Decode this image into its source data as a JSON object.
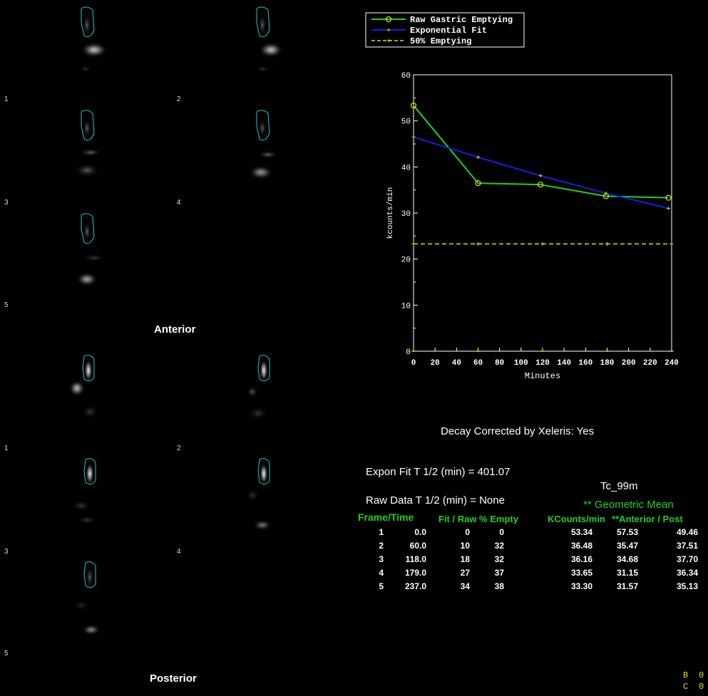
{
  "views": {
    "anterior_label": "Anterior",
    "posterior_label": "Posterior",
    "anterior_frames": [
      "1",
      "2",
      "3",
      "4",
      "5"
    ],
    "posterior_frames": [
      "1",
      "2",
      "3",
      "4",
      "5"
    ]
  },
  "colors": {
    "roi": "#20c8c8",
    "raw": "#20d020",
    "fit": "#1020e0",
    "half": "#e8e000",
    "accent_green": "#20d020"
  },
  "chart_data": {
    "type": "line",
    "xlabel": "Minutes",
    "ylabel": "kcounts/min",
    "xlim": [
      0,
      240
    ],
    "ylim": [
      0,
      60
    ],
    "x_ticks": [
      "0",
      "20",
      "40",
      "60",
      "80",
      "100",
      "120",
      "140",
      "160",
      "180",
      "200",
      "220",
      "240"
    ],
    "y_ticks": [
      "0",
      "10",
      "20",
      "30",
      "40",
      "50",
      "60"
    ],
    "legend_position": "top-left",
    "grid": false,
    "series": [
      {
        "name": "Raw Gastric Emptying",
        "color": "#20d020",
        "marker": "circle",
        "x": [
          0,
          60,
          118,
          179,
          237
        ],
        "y": [
          53.34,
          36.48,
          36.16,
          33.65,
          33.3
        ]
      },
      {
        "name": "Exponential Fit",
        "color": "#1020e0",
        "marker": "plus",
        "x": [
          0,
          60,
          118,
          179,
          237
        ],
        "y": [
          46.5,
          42.1,
          38.1,
          34.3,
          31.0
        ]
      },
      {
        "name": "50% Emptying",
        "color": "#e8e000",
        "marker": "plus",
        "dashed": true,
        "x": [
          0,
          60,
          120,
          180,
          240
        ],
        "y": [
          23.3,
          23.3,
          23.3,
          23.3,
          23.3
        ]
      }
    ]
  },
  "summary": {
    "decay": "Decay Corrected by Xeleris: Yes",
    "expon_fit": "Expon Fit T 1/2 (min) = 401.07",
    "raw_data": "Raw Data T 1/2 (min) = None",
    "isotope": "Tc_99m",
    "geo_mean": "** Geometric Mean"
  },
  "table": {
    "headers": {
      "frame_time": "Frame/Time",
      "fit_raw": "Fit / Raw % Empty",
      "kcounts": "KCounts/min",
      "ant_post": "**Anterior / Post"
    },
    "rows": [
      [
        "1",
        "0.0",
        "0",
        "0",
        "53.34",
        "57.53",
        "49.46"
      ],
      [
        "2",
        "60.0",
        "10",
        "32",
        "36.48",
        "35.47",
        "37.51"
      ],
      [
        "3",
        "118.0",
        "18",
        "32",
        "36.16",
        "34.68",
        "37.70"
      ],
      [
        "4",
        "179.0",
        "27",
        "37",
        "33.65",
        "31.15",
        "36.34"
      ],
      [
        "5",
        "237.0",
        "34",
        "38",
        "33.30",
        "31.57",
        "35.13"
      ]
    ]
  },
  "status": {
    "b_label": "B",
    "b_value": "0",
    "c_label": "C",
    "c_value": "0"
  }
}
